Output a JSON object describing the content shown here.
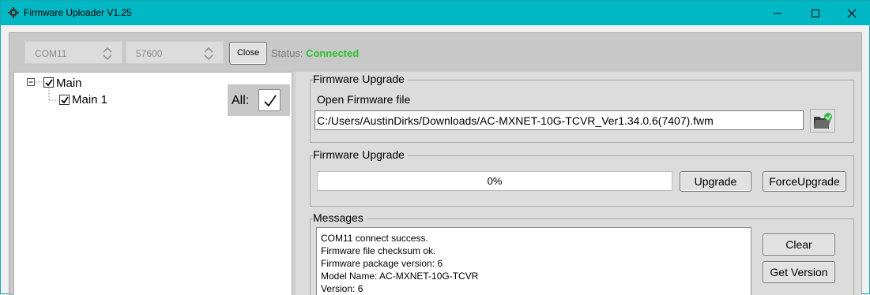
{
  "window": {
    "title": "Firmware Uploader V1.25",
    "accent_color": "#00b8c4"
  },
  "toolbar": {
    "port_value": "COM11",
    "baud_value": "57600",
    "close_label": "Close",
    "status_label": "Status:",
    "status_value": "Connected",
    "status_color": "#2bc22b"
  },
  "tree": {
    "root_label": "Main",
    "child_label": "Main 1",
    "all_label": "All:"
  },
  "firmware_file": {
    "group_title": "Firmware Upgrade",
    "open_label": "Open Firmware file",
    "path": "C:/Users/AustinDirks/Downloads/AC-MXNET-10G-TCVR_Ver1.34.0.6(7407).fwm",
    "folder_icon": "open-folder-icon"
  },
  "upgrade": {
    "group_title": "Firmware Upgrade",
    "progress_text": "0%",
    "progress_value": 0,
    "upgrade_label": "Upgrade",
    "force_label": "ForceUpgrade"
  },
  "messages": {
    "group_title": "Messages",
    "lines": [
      "COM11 connect success.",
      "Firmware file checksum ok.",
      "Firmware package version: 6",
      "Model Name: AC-MXNET-10G-TCVR",
      "Version: 6"
    ],
    "clear_label": "Clear",
    "get_version_label": "Get Version"
  }
}
